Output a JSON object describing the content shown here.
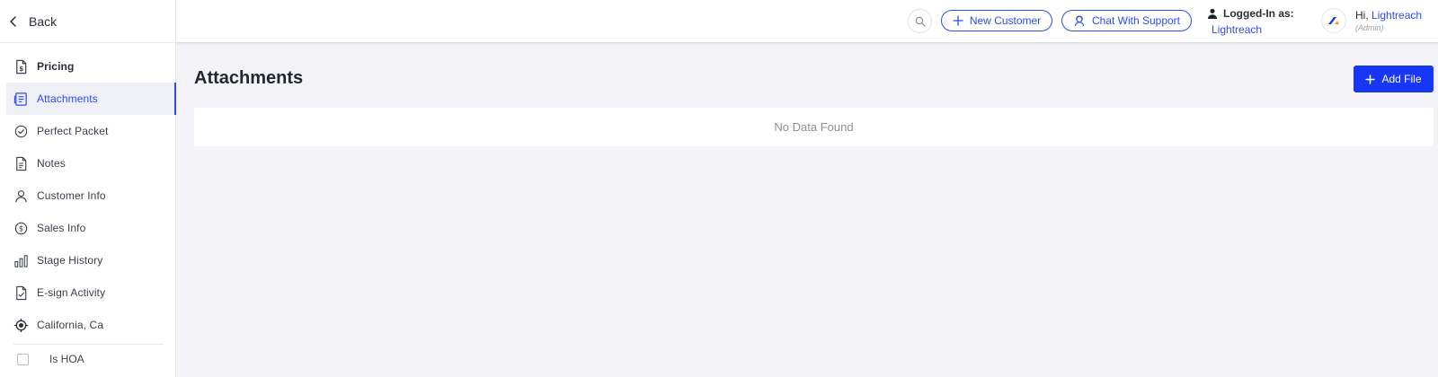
{
  "sidebar": {
    "back_label": "Back",
    "items": [
      {
        "label": "Pricing",
        "icon": "pricing-doc-icon"
      },
      {
        "label": "Attachments",
        "icon": "attachment-doc-icon"
      },
      {
        "label": "Perfect Packet",
        "icon": "check-circle-icon"
      },
      {
        "label": "Notes",
        "icon": "notes-doc-icon"
      },
      {
        "label": "Customer Info",
        "icon": "user-icon"
      },
      {
        "label": "Sales Info",
        "icon": "dollar-circle-icon"
      },
      {
        "label": "Stage History",
        "icon": "bar-chart-icon"
      },
      {
        "label": "E-sign Activity",
        "icon": "esign-doc-icon"
      },
      {
        "label": "California, Ca",
        "icon": "location-target-icon"
      }
    ],
    "active_item": "Attachments",
    "hoa_label": "Is HOA",
    "hoa_checked": false
  },
  "header": {
    "new_customer_label": "New Customer",
    "chat_support_label": "Chat With Support",
    "logged_in_label": "Logged-In as:",
    "logged_in_name": "Lightreach",
    "greeting": "Hi,",
    "user_name": "Lightreach",
    "user_role": "(Admin)"
  },
  "main": {
    "title": "Attachments",
    "add_file_label": "Add File",
    "empty_message": "No Data Found"
  },
  "colors": {
    "accent": "#2c4df0",
    "primary_button": "#1737f5",
    "background": "#f4f4f8",
    "panel": "#ffffff"
  }
}
